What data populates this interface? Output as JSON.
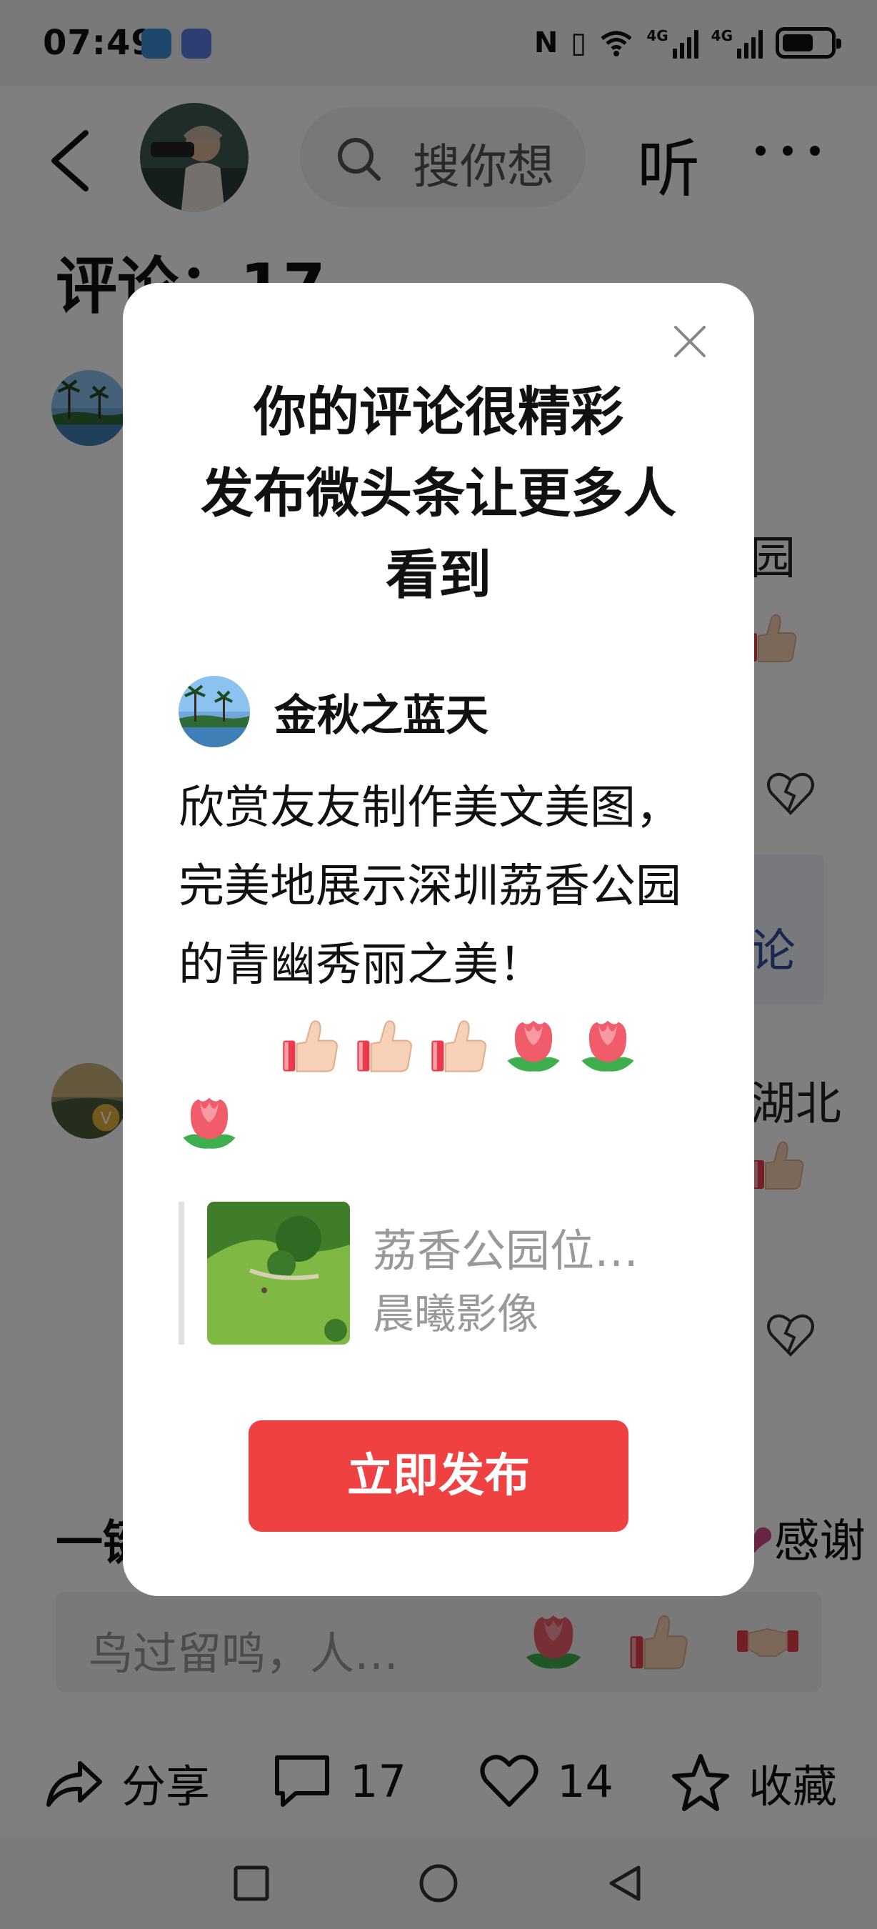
{
  "status_bar": {
    "time": "07:49",
    "network_tag_1": "4G",
    "network_tag_2": "4G",
    "nfc_glyph": "N",
    "vibrate_glyph": "▯",
    "battery_level": 0.65
  },
  "header": {
    "search_placeholder": "搜你想",
    "listen_label": "听"
  },
  "comments": {
    "title": "评论：17",
    "partial_1": "园",
    "partial_blue": "论",
    "partial_2": "湖北"
  },
  "quick_reply": {
    "left_text": "一键",
    "right_text": "感谢"
  },
  "comment_input": {
    "placeholder": "鸟过留鸣，人…"
  },
  "actions": {
    "share_label": "分享",
    "comment_count": "17",
    "like_count": "14",
    "favorite_label": "收藏"
  },
  "modal": {
    "title_line_1": "你的评论很精彩",
    "title_line_2": "发布微头条让更多人",
    "title_line_3": "看到",
    "comment": {
      "username": "金秋之蓝天",
      "text": "欣赏友友制作美文美图，完美地展示深圳荔香公园的青幽秀丽之美！"
    },
    "article": {
      "title": "荔香公园位…",
      "author": "晨曦影像"
    },
    "publish_button": "立即发布"
  },
  "colors": {
    "accent_red": "#f04142",
    "overlay": "rgba(0,0,0,0.5)",
    "link_blue": "#2e4f9e"
  }
}
